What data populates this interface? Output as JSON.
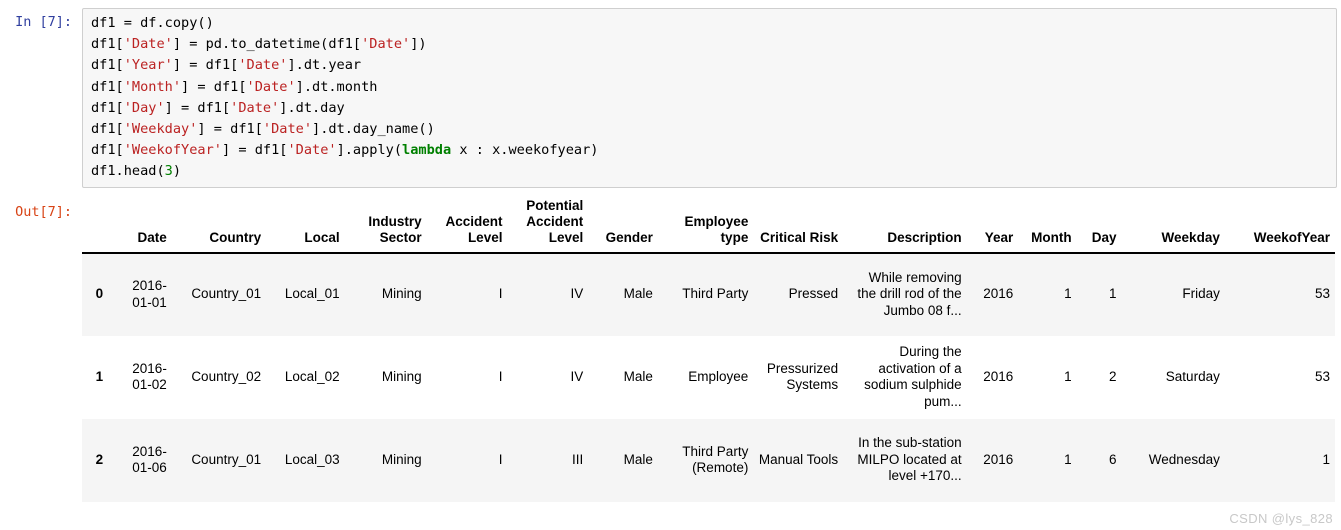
{
  "input_cell": {
    "prompt": "In [7]:",
    "lines": [
      [
        {
          "t": "df1 = df.copy()",
          "c": "plain"
        }
      ],
      [
        {
          "t": "df1[",
          "c": "plain"
        },
        {
          "t": "'Date'",
          "c": "str"
        },
        {
          "t": "] = pd.to_datetime(df1[",
          "c": "plain"
        },
        {
          "t": "'Date'",
          "c": "str"
        },
        {
          "t": "])",
          "c": "plain"
        }
      ],
      [
        {
          "t": "df1[",
          "c": "plain"
        },
        {
          "t": "'Year'",
          "c": "str"
        },
        {
          "t": "] = df1[",
          "c": "plain"
        },
        {
          "t": "'Date'",
          "c": "str"
        },
        {
          "t": "].dt.year",
          "c": "plain"
        }
      ],
      [
        {
          "t": "df1[",
          "c": "plain"
        },
        {
          "t": "'Month'",
          "c": "str"
        },
        {
          "t": "] = df1[",
          "c": "plain"
        },
        {
          "t": "'Date'",
          "c": "str"
        },
        {
          "t": "].dt.month",
          "c": "plain"
        }
      ],
      [
        {
          "t": "df1[",
          "c": "plain"
        },
        {
          "t": "'Day'",
          "c": "str"
        },
        {
          "t": "] = df1[",
          "c": "plain"
        },
        {
          "t": "'Date'",
          "c": "str"
        },
        {
          "t": "].dt.day",
          "c": "plain"
        }
      ],
      [
        {
          "t": "df1[",
          "c": "plain"
        },
        {
          "t": "'Weekday'",
          "c": "str"
        },
        {
          "t": "] = df1[",
          "c": "plain"
        },
        {
          "t": "'Date'",
          "c": "str"
        },
        {
          "t": "].dt.day_name()",
          "c": "plain"
        }
      ],
      [
        {
          "t": "df1[",
          "c": "plain"
        },
        {
          "t": "'WeekofYear'",
          "c": "str"
        },
        {
          "t": "] = df1[",
          "c": "plain"
        },
        {
          "t": "'Date'",
          "c": "str"
        },
        {
          "t": "].apply(",
          "c": "plain"
        },
        {
          "t": "lambda",
          "c": "kw"
        },
        {
          "t": " x : x.weekofyear)",
          "c": "plain"
        }
      ],
      [
        {
          "t": "df1.head(",
          "c": "plain"
        },
        {
          "t": "3",
          "c": "num"
        },
        {
          "t": ")",
          "c": "plain"
        }
      ]
    ]
  },
  "output_cell": {
    "prompt": "Out[7]:",
    "table": {
      "index_header": "",
      "columns": [
        "Date",
        "Country",
        "Local",
        "Industry Sector",
        "Accident Level",
        "Potential Accident Level",
        "Gender",
        "Employee type",
        "Critical Risk",
        "Description",
        "Year",
        "Month",
        "Day",
        "Weekday",
        "WeekofYear"
      ],
      "rows": [
        {
          "index": "0",
          "cells": [
            "2016-01-01",
            "Country_01",
            "Local_01",
            "Mining",
            "I",
            "IV",
            "Male",
            "Third Party",
            "Pressed",
            "While removing the drill rod of the Jumbo 08 f...",
            "2016",
            "1",
            "1",
            "Friday",
            "53"
          ]
        },
        {
          "index": "1",
          "cells": [
            "2016-01-02",
            "Country_02",
            "Local_02",
            "Mining",
            "I",
            "IV",
            "Male",
            "Employee",
            "Pressurized Systems",
            "During the activation of a sodium sulphide pum...",
            "2016",
            "1",
            "2",
            "Saturday",
            "53"
          ]
        },
        {
          "index": "2",
          "cells": [
            "2016-01-06",
            "Country_01",
            "Local_03",
            "Mining",
            "I",
            "III",
            "Male",
            "Third Party (Remote)",
            "Manual Tools",
            "In the sub-station MILPO located at level +170...",
            "2016",
            "1",
            "6",
            "Wednesday",
            "1"
          ]
        }
      ]
    }
  },
  "watermark": "CSDN @lys_828",
  "colors": {
    "prompt_in": "#303f9f",
    "prompt_out": "#d84315",
    "code_bg": "#f7f7f7",
    "code_border": "#cfcfcf",
    "string": "#bb2222",
    "keyword": "#008000",
    "row_alt_bg": "#f5f5f5"
  }
}
